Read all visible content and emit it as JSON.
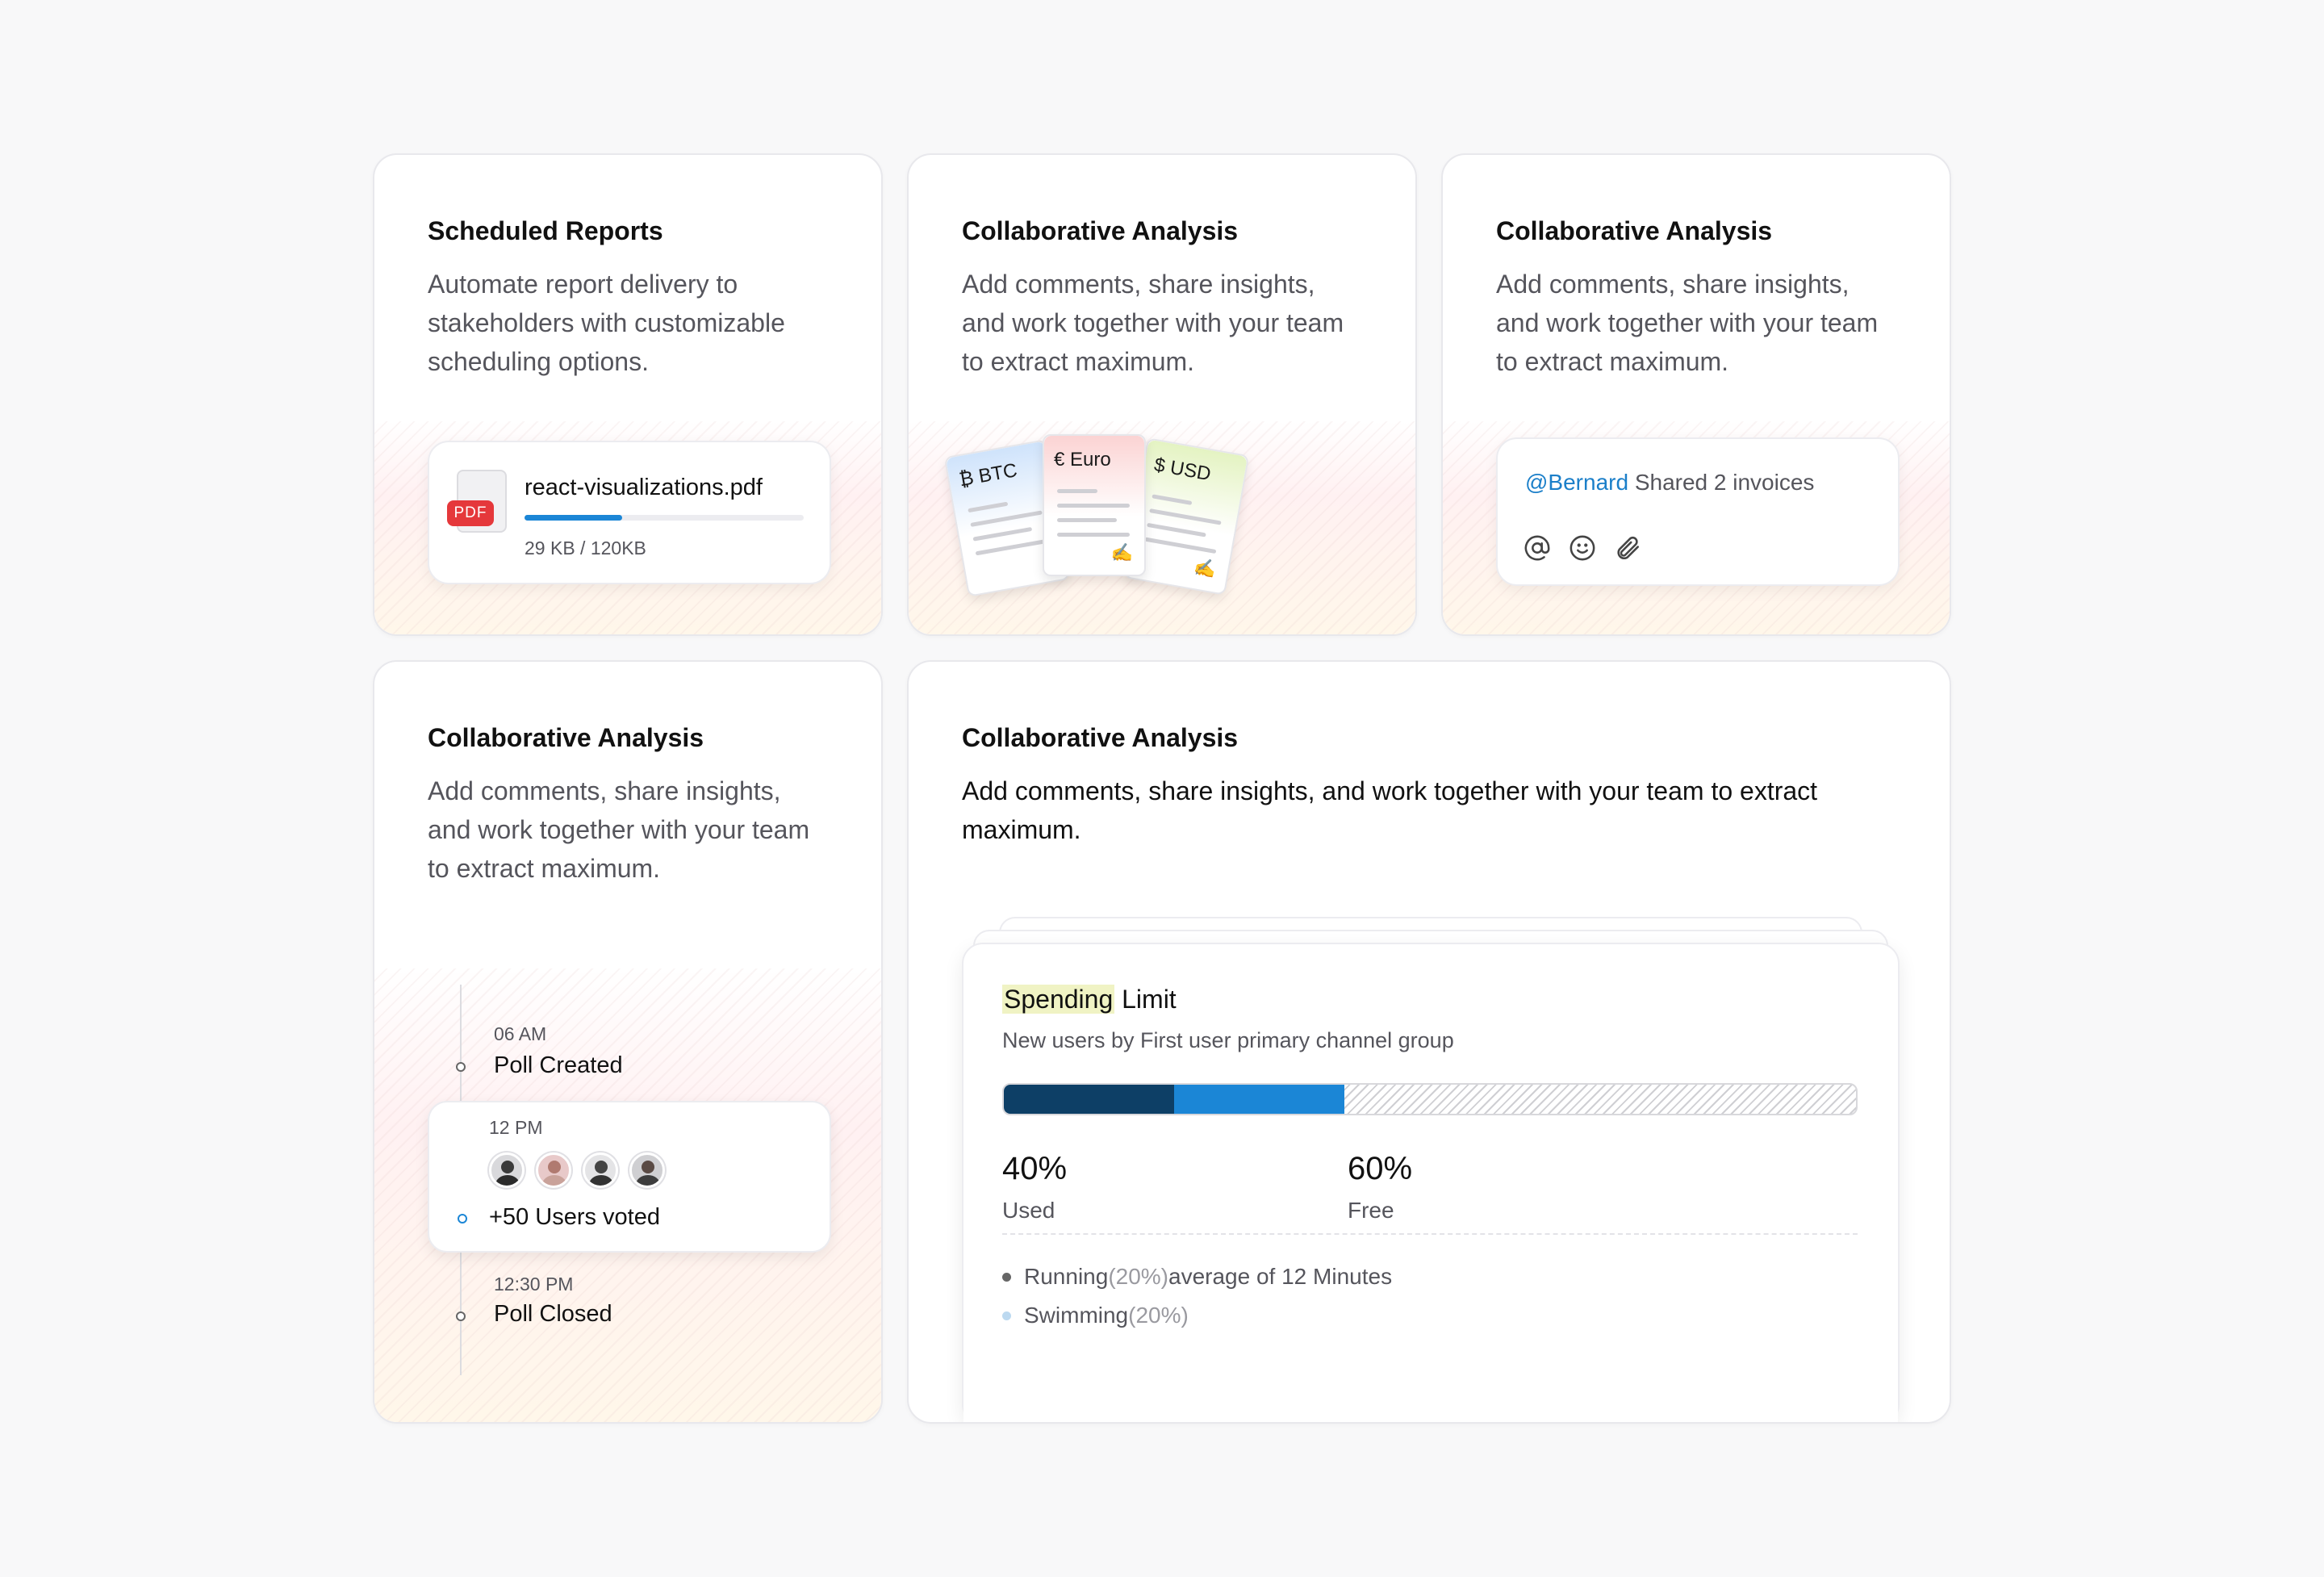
{
  "cards": {
    "scheduled": {
      "title": "Scheduled Reports",
      "desc_lines": [
        "Automate report delivery to",
        "stakeholders with customizable",
        "scheduling options."
      ],
      "file": {
        "badge": "PDF",
        "name": "react-visualizations.pdf",
        "size": "29 KB / 120KB",
        "progress": 0.35
      }
    },
    "currency": {
      "title": "Collaborative Analysis",
      "desc_lines": [
        "Add comments, share insights,",
        "and work together with your team",
        "to extract maximum."
      ],
      "tickets": [
        {
          "symbol": "₿",
          "label": "BTC",
          "color": "#cfe3fb"
        },
        {
          "symbol": "€",
          "label": "Euro",
          "color": "#fbd3d3"
        },
        {
          "symbol": "$",
          "label": "USD",
          "color": "#e4f3c2"
        }
      ]
    },
    "comments": {
      "title": "Collaborative Analysis",
      "desc_lines": [
        "Add comments, share insights,",
        "and work together with your team",
        "to extract maximum."
      ],
      "mention": "@Bernard",
      "text": " Shared 2 invoices",
      "icons": [
        "at-icon",
        "smile-icon",
        "paperclip-icon"
      ]
    },
    "timeline": {
      "title": "Collaborative Analysis",
      "desc_lines": [
        "Add comments, share insights,",
        "and work together with your team",
        "to extract maximum."
      ],
      "events": [
        {
          "time": "06 AM",
          "label": "Poll Created"
        },
        {
          "time": "12 PM",
          "label": "+50 Users voted"
        },
        {
          "time": "12:30 PM",
          "label": "Poll Closed"
        }
      ]
    },
    "spending": {
      "title": "Collaborative Analysis",
      "desc_lines": [
        "Add comments, share insights, and work together with your team to extract",
        "maximum."
      ],
      "widget": {
        "title_highlight": "Spending",
        "title_rest": " Limit",
        "subtitle": "New users by First user primary channel group",
        "segments": [
          {
            "value": 0.2,
            "color": "#0d3f66"
          },
          {
            "value": 0.2,
            "color": "#1b86d6"
          }
        ],
        "used": {
          "value": "40%",
          "label": "Used"
        },
        "free": {
          "value": "60%",
          "label": "Free"
        },
        "legend": [
          {
            "name": "Running",
            "pct": " (20%)",
            "suffix": " average of 12 Minutes",
            "color": "#666"
          },
          {
            "name": "Swimming",
            "pct": " (20%)",
            "suffix": "",
            "color": "#bcd9f0"
          }
        ]
      }
    }
  }
}
